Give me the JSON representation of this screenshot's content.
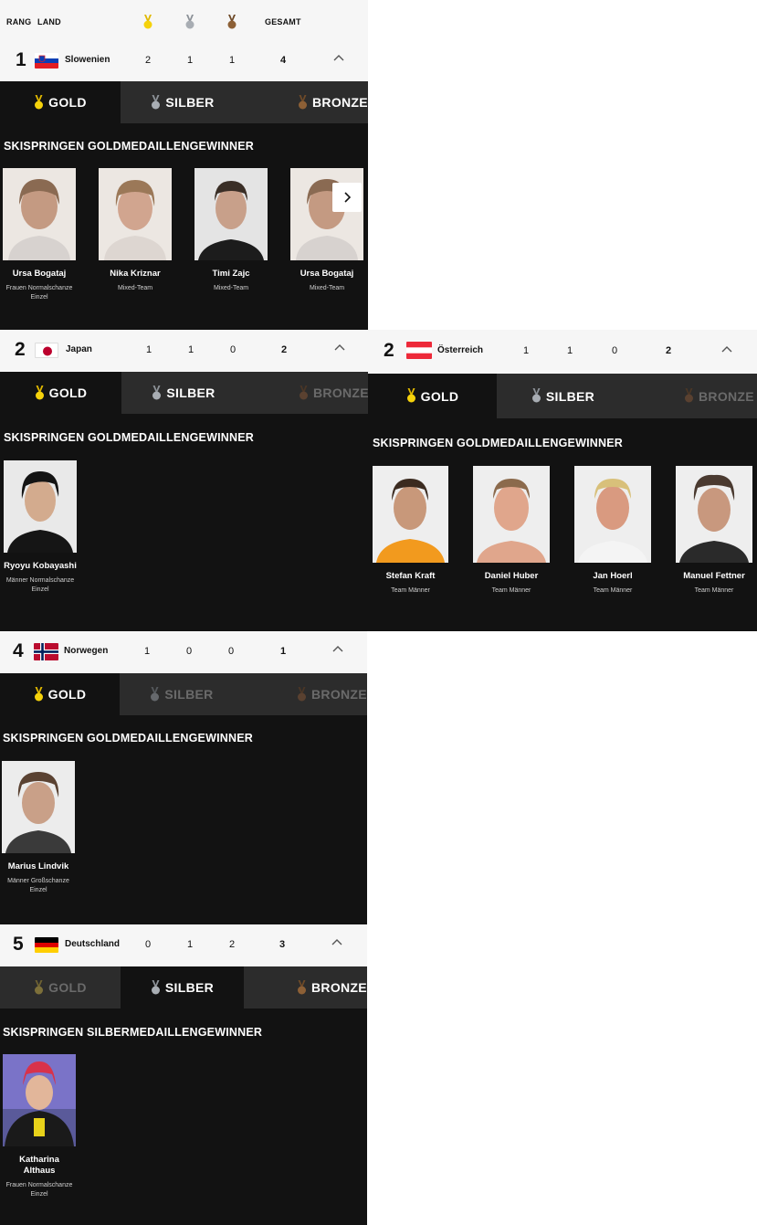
{
  "header": {
    "rank": "RANG",
    "country": "LAND",
    "total": "GESAMT"
  },
  "colors": {
    "gold": "#f5d20b",
    "silver": "#a8adb3",
    "bronze": "#8d6036",
    "panel": "#121212",
    "row": "#f6f6f6"
  },
  "tabs": {
    "gold": "GOLD",
    "silver": "SILBER",
    "bronze": "BRONZE"
  },
  "countries": [
    {
      "rank": "1",
      "name": "Slowenien",
      "gold": "2",
      "silver": "1",
      "bronze": "1",
      "total": "4",
      "section_title": "SKISPRINGEN GOLDMEDAILLENGEWINNER",
      "athletes": [
        {
          "name": "Ursa Bogataj",
          "event": "Frauen Normalschanze Einzel"
        },
        {
          "name": "Nika Kriznar",
          "event": "Mixed-Team"
        },
        {
          "name": "Timi Zajc",
          "event": "Mixed-Team"
        },
        {
          "name": "Ursa Bogataj",
          "event": "Mixed-Team"
        }
      ]
    },
    {
      "rank": "2",
      "name": "Japan",
      "gold": "1",
      "silver": "1",
      "bronze": "0",
      "total": "2",
      "section_title": "SKISPRINGEN GOLDMEDAILLENGEWINNER",
      "athletes": [
        {
          "name": "Ryoyu Kobayashi",
          "event": "Männer Normalschanze Einzel"
        }
      ]
    },
    {
      "rank": "2",
      "name": "Österreich",
      "gold": "1",
      "silver": "1",
      "bronze": "0",
      "total": "2",
      "section_title": "SKISPRINGEN GOLDMEDAILLENGEWINNER",
      "athletes": [
        {
          "name": "Stefan Kraft",
          "event": "Team Männer"
        },
        {
          "name": "Daniel Huber",
          "event": "Team Männer"
        },
        {
          "name": "Jan Hoerl",
          "event": "Team Männer"
        },
        {
          "name": "Manuel Fettner",
          "event": "Team Männer"
        }
      ]
    },
    {
      "rank": "4",
      "name": "Norwegen",
      "gold": "1",
      "silver": "0",
      "bronze": "0",
      "total": "1",
      "section_title": "SKISPRINGEN GOLDMEDAILLENGEWINNER",
      "athletes": [
        {
          "name": "Marius Lindvik",
          "event": "Männer Großschanze Einzel"
        }
      ]
    },
    {
      "rank": "5",
      "name": "Deutschland",
      "gold": "0",
      "silver": "1",
      "bronze": "2",
      "total": "3",
      "section_title": "SKISPRINGEN SILBERMEDAILLENGEWINNER",
      "athletes": [
        {
          "name": "Katharina Althaus",
          "event": "Frauen Normalschanze Einzel"
        }
      ]
    }
  ]
}
